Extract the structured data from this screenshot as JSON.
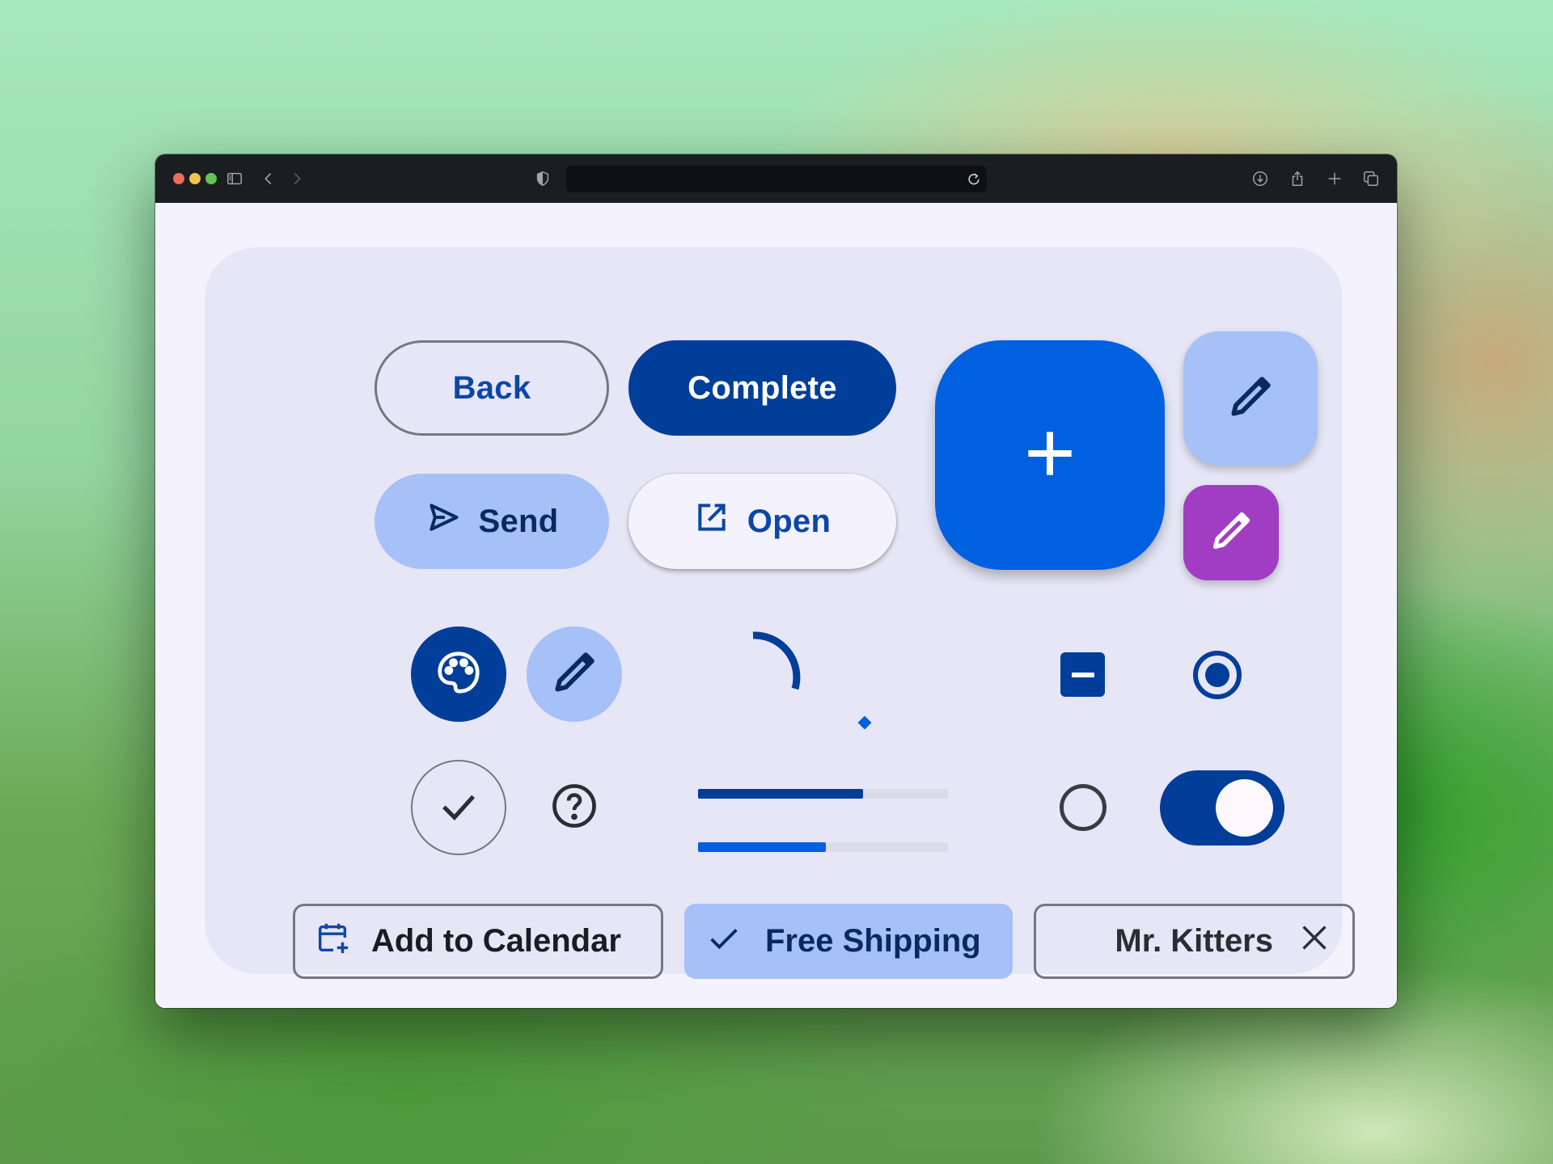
{
  "browser": {
    "address_text": "",
    "icons": [
      "sidebar-icon",
      "back-arrow-icon",
      "forward-arrow-icon",
      "shield-icon",
      "reload-icon",
      "download-icon",
      "share-icon",
      "new-tab-icon",
      "tabs-overview-icon"
    ]
  },
  "buttons": {
    "back_label": "Back",
    "complete_label": "Complete",
    "send_label": "Send",
    "open_label": "Open"
  },
  "fabs": {
    "large_icon": "plus-icon",
    "small_icon": "pencil-icon",
    "purple_icon": "pencil-icon"
  },
  "icon_buttons": [
    "palette-icon",
    "pencil-icon",
    "check-icon",
    "help-icon"
  ],
  "progress": {
    "linear_primary": 0.66,
    "linear_secondary": 0.51
  },
  "controls": {
    "checkbox_state": "indeterminate",
    "radio_selected": true,
    "radio_unselected": false,
    "switch_on": true
  },
  "chips": {
    "calendar_label": "Add to Calendar",
    "shipping_label": "Free Shipping",
    "kitters_label": "Mr. Kitters"
  },
  "colors": {
    "primary": "#003e99",
    "fab_blue": "#0060e0",
    "tonal": "#a6c0f8",
    "purple": "#a13dc3",
    "surface": "#e6e6f6"
  }
}
